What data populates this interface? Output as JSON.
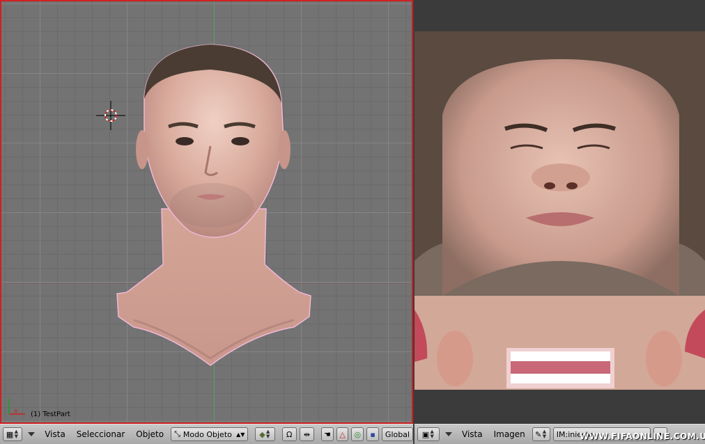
{
  "viewport3d": {
    "object_label": "(1) TestPart"
  },
  "header_left": {
    "editor_type_icon": "grid-icon",
    "menus": [
      "Vista",
      "Seleccionar",
      "Objeto"
    ],
    "mode_dropdown": {
      "icon": "object-mode-icon",
      "value": "Modo Objeto"
    },
    "shading_icon": "solid-shading-icon",
    "pivot_icon": "pivot-icon",
    "manipulator_icons": [
      "hand-icon",
      "translate-icon",
      "rotate-icon",
      "scale-icon"
    ],
    "orientation": "Global"
  },
  "header_right": {
    "editor_type_icon": "image-editor-icon",
    "menus": [
      "Vista",
      "Imagen"
    ],
    "pin_icon": "pin-icon",
    "image_field": "IM:iniesta"
  },
  "watermark": "WWW.FIFAONLINE.COM.UA",
  "colors": {
    "viewport_bg": "#737373",
    "active_border": "#d02020",
    "header_bg": "#b4b4b4",
    "skin": "#d9a89a"
  }
}
